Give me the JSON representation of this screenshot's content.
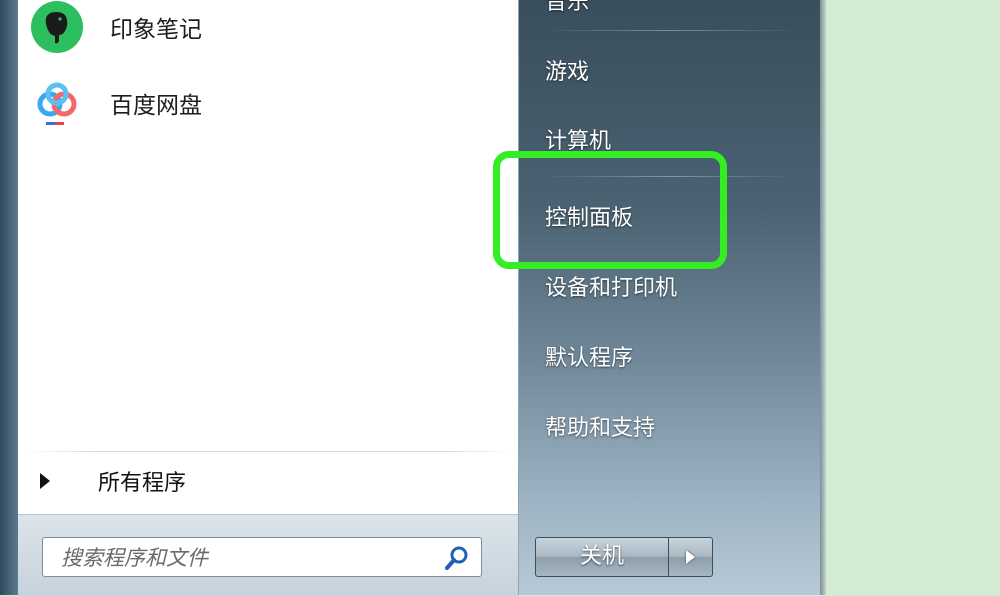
{
  "pinned_programs": [
    {
      "label": "印象笔记",
      "icon": "evernote-elephant-icon"
    },
    {
      "label": "百度网盘",
      "icon": "baidu-netdisk-icon"
    }
  ],
  "all_programs": {
    "label": "所有程序",
    "icon": "triangle-right-icon"
  },
  "search": {
    "placeholder": "搜索程序和文件",
    "icon": "magnifier-icon"
  },
  "right_menu": {
    "partial_top": "音乐",
    "items": [
      "游戏",
      "计算机",
      "控制面板",
      "设备和打印机",
      "默认程序",
      "帮助和支持"
    ],
    "highlighted": "控制面板"
  },
  "shutdown": {
    "label": "关机",
    "arrow_icon": "triangle-right-icon"
  },
  "colors": {
    "highlight": "#33ee22",
    "evernote_green": "#2dbe60",
    "background_right": "#d3ead3"
  }
}
